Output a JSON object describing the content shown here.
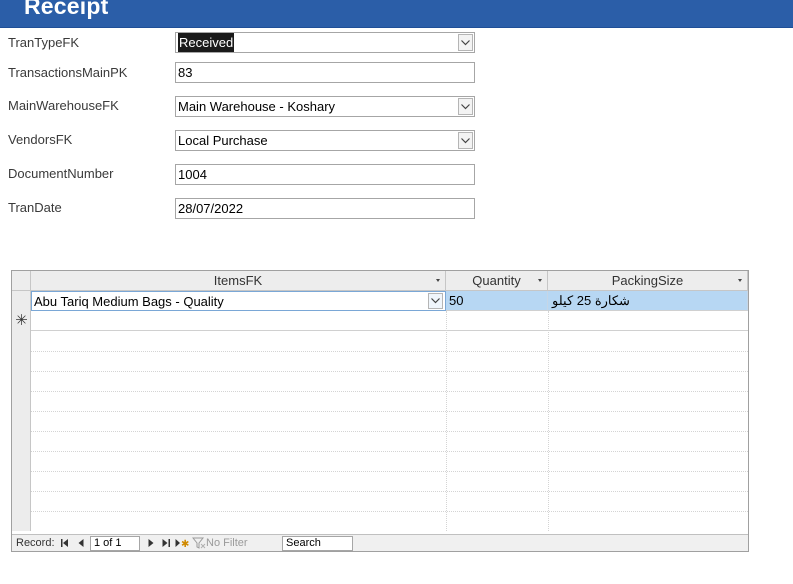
{
  "form": {
    "title": "Receipt",
    "fields": {
      "tran_type": {
        "label": "TranTypeFK",
        "value": "Received"
      },
      "transactions_main_pk": {
        "label": "TransactionsMainPK",
        "value": "83"
      },
      "main_warehouse": {
        "label": "MainWarehouseFK",
        "value": "Main Warehouse - Koshary"
      },
      "vendors": {
        "label": "VendorsFK",
        "value": "Local Purchase"
      },
      "document_number": {
        "label": "DocumentNumber",
        "value": "1004"
      },
      "tran_date": {
        "label": "TranDate",
        "value": "28/07/2022"
      }
    }
  },
  "grid": {
    "columns": [
      "ItemsFK",
      "Quantity",
      "PackingSize"
    ],
    "rows": [
      {
        "items_fk": "Abu Tariq Medium Bags - Quality",
        "quantity": "50",
        "packing_size": "شكارة 25 كيلو"
      }
    ],
    "new_record_marker": "✳"
  },
  "navigation": {
    "record_label": "Record:",
    "position": "1 of 1",
    "filter_label": "No Filter",
    "search_label": "Search"
  },
  "icons": {
    "dropdown": "chevron-down-icon",
    "first": "first-record-icon",
    "prev": "previous-record-icon",
    "next": "next-record-icon",
    "last": "last-record-icon",
    "new": "new-record-icon",
    "filter": "filter-icon"
  },
  "colors": {
    "header": "#2b5ea8",
    "selected_row": "#b7d7f3"
  }
}
